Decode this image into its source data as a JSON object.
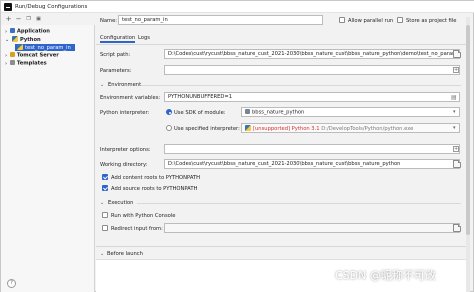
{
  "window": {
    "title": "Run/Debug Configurations"
  },
  "tree": {
    "items": [
      {
        "label": "Application",
        "level": 0,
        "bold": true
      },
      {
        "label": "Python",
        "level": 0,
        "bold": true
      },
      {
        "label": "test_no_param_in",
        "level": 1,
        "bold": false,
        "selected": true
      },
      {
        "label": "Tomcat Server",
        "level": 0,
        "bold": true
      },
      {
        "label": "Templates",
        "level": 0,
        "bold": true
      }
    ]
  },
  "header": {
    "name_label": "Name:",
    "name_value": "test_no_param_in",
    "allow_parallel_label": "Allow parallel run",
    "store_project_label": "Store as project file"
  },
  "tabs": [
    {
      "label": "Configuration"
    },
    {
      "label": "Logs"
    }
  ],
  "config": {
    "script_path_label": "Script path:",
    "script_path_value": "D:\\Codes\\cust\\rycust\\bbss_nature_cust_2021-2030\\bbss_nature_cust\\bbss_nature_python\\demo\\test_no_param_in",
    "parameters_label": "Parameters:",
    "environment_section": "Environment",
    "env_vars_label": "Environment variables:",
    "env_vars_value": "PYTHONUNBUFFERED=1",
    "python_interpreter_label": "Python interpreter:",
    "use_sdk_label": "Use SDK of module:",
    "module_value": "bbss_nature_python",
    "use_specified_label": "Use specified interpreter:",
    "interpreter_unsupported": "[unsupported] Python 3.1",
    "interpreter_path": "D:/DevelopTools/Python/python.exe",
    "interpreter_options_label": "Interpreter options:",
    "working_dir_label": "Working directory:",
    "working_dir_value": "D:\\Codes\\cust\\rycust\\bbss_nature_cust_2021-2030\\bbss_nature_cust\\bbss_nature_python",
    "add_content_roots_label": "Add content roots to PYTHONPATH",
    "add_source_roots_label": "Add source roots to PYTHONPATH",
    "execution_section": "Execution",
    "run_console_label": "Run with Python Console",
    "redirect_input_label": "Redirect input from:",
    "before_launch_label": "Before launch"
  },
  "watermark": "CSDN @昵称不可改"
}
